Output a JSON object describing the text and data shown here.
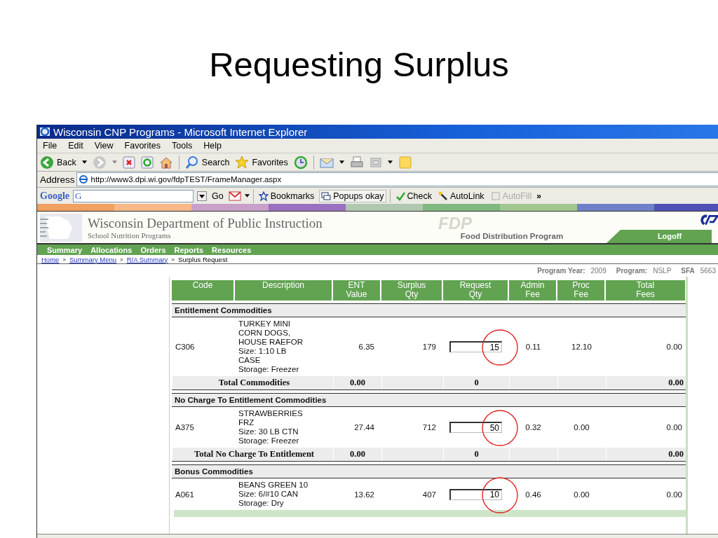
{
  "slide_title": "Requesting Surplus",
  "window": {
    "title": "Wisconsin CNP Programs - Microsoft Internet Explorer"
  },
  "menu": [
    "File",
    "Edit",
    "View",
    "Favorites",
    "Tools",
    "Help"
  ],
  "toolbar": {
    "back": "Back",
    "search": "Search",
    "favorites": "Favorites"
  },
  "address": {
    "label": "Address",
    "value": "http://www3.dpi.wi.gov/fdpTEST/FrameManager.aspx"
  },
  "google_bar": {
    "logo": "Google",
    "field_logo": "G",
    "go": "Go",
    "bookmarks": "Bookmarks",
    "popups": "Popups okay",
    "check": "Check",
    "autolink": "AutoLink",
    "autofill": "AutoFill",
    "more": "»"
  },
  "site": {
    "title": "Wisconsin Department of Public Instruction",
    "subtitle": "School Nutrition Programs",
    "watermark": "FDP",
    "program": "Food Distribution Program",
    "logoff": "Logoff"
  },
  "nav": [
    "Summary",
    "Allocations",
    "Orders",
    "Reports",
    "Resources"
  ],
  "breadcrumb": [
    {
      "label": "Home",
      "link": true
    },
    {
      "label": "Summary Menu",
      "link": true
    },
    {
      "label": "R/A Summary",
      "link": true
    },
    {
      "label": "Surplus Request",
      "link": false
    }
  ],
  "breadcrumb_separator": ">",
  "info": [
    {
      "label": "Program Year:",
      "value": "2009"
    },
    {
      "label": "Program:",
      "value": "NSLP"
    },
    {
      "label": "SFA",
      "value": "5663"
    }
  ],
  "table": {
    "columns": [
      [
        "Code"
      ],
      [
        "Description"
      ],
      [
        "ENT",
        "Value"
      ],
      [
        "Surplus",
        "Qty"
      ],
      [
        "Request",
        "Qty"
      ],
      [
        "Admin",
        "Fee"
      ],
      [
        "Proc",
        "Fee"
      ],
      [
        "Total",
        "Fees"
      ]
    ],
    "sections": [
      {
        "title": "Entitlement Commodities",
        "items": [
          {
            "code": "C306",
            "description": "TURKEY MINI\nCORN DOGS,\nHOUSE RAEFOR\nSize:  1:10 LB\nCASE\nStorage:  Freezer",
            "ent_value": "6.35",
            "surplus_qty": "179",
            "request_qty": "15",
            "admin_fee": "0.11",
            "proc_fee": "12.10",
            "total_fees": "0.00",
            "circled": true
          }
        ],
        "total": {
          "label": "Total Commodities",
          "ent_value": "0.00",
          "request_qty": "0",
          "total_fees": "0.00"
        }
      },
      {
        "title": "No Charge To Entitlement Commodities",
        "items": [
          {
            "code": "A375",
            "description": "STRAWBERRIES\nFRZ\nSize:  30 LB CTN\nStorage:  Freezer",
            "ent_value": "27.44",
            "surplus_qty": "712",
            "request_qty": "50",
            "admin_fee": "0.32",
            "proc_fee": "0.00",
            "total_fees": "0.00",
            "circled": true
          }
        ],
        "total": {
          "label": "Total No Charge To Entitlement",
          "ent_value": "0.00",
          "request_qty": "0",
          "total_fees": "0.00"
        }
      },
      {
        "title": "Bonus Commodities",
        "items": [
          {
            "code": "A061",
            "description": "BEANS GREEN 10\nSize:  6/#10 CAN\nStorage:  Dry",
            "ent_value": "13.62",
            "surplus_qty": "407",
            "request_qty": "10",
            "admin_fee": "0.46",
            "proc_fee": "0.00",
            "total_fees": "0.00",
            "circled": true
          }
        ]
      }
    ]
  }
}
